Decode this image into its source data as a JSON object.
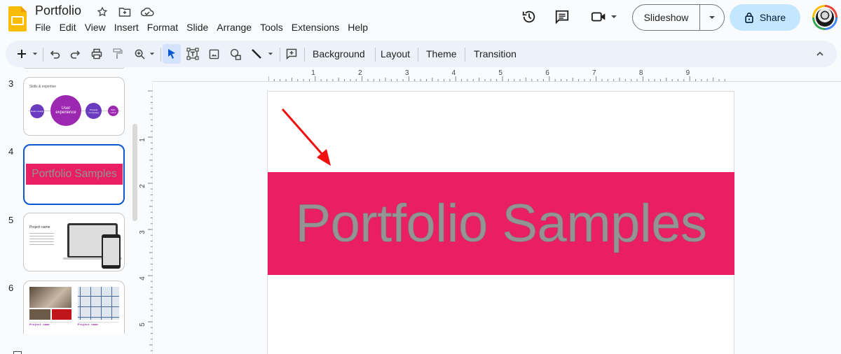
{
  "app": {
    "title": "Portfolio",
    "menu": [
      "File",
      "Edit",
      "View",
      "Insert",
      "Format",
      "Slide",
      "Arrange",
      "Tools",
      "Extensions",
      "Help"
    ],
    "title_icons": [
      "star-icon",
      "move-to-folder-icon",
      "cloud-saved-icon"
    ]
  },
  "header": {
    "slideshow_label": "Slideshow",
    "share_label": "Share",
    "icons": [
      "version-history-icon",
      "comments-icon",
      "meet-icon"
    ]
  },
  "toolbar": {
    "buttons": [
      "new-slide",
      "undo",
      "redo",
      "print",
      "paint-format",
      "zoom",
      "select",
      "text-box",
      "image",
      "shape",
      "line",
      "comment"
    ],
    "background_label": "Background",
    "layout_label": "Layout",
    "theme_label": "Theme",
    "transition_label": "Transition"
  },
  "filmstrip": {
    "slides": [
      {
        "number": "3",
        "title": "Skills & expertise",
        "bubbles": [
          "Motion design",
          "User experience",
          "Physical Computing",
          "Web, UX/UI"
        ]
      },
      {
        "number": "4",
        "title": "Portfolio Samples",
        "selected": true
      },
      {
        "number": "5",
        "title": "Project name"
      },
      {
        "number": "6",
        "captions": [
          "Project name",
          "Project name"
        ]
      }
    ]
  },
  "rulers": {
    "horizontal": [
      "1",
      "2",
      "3",
      "4",
      "5",
      "6",
      "7",
      "8",
      "9"
    ],
    "vertical": [
      "1",
      "2",
      "3",
      "4",
      "5"
    ]
  },
  "slide": {
    "title_text": "Portfolio Samples",
    "band_color": "#e91e63",
    "text_color": "#949494",
    "annotation": "red-arrow"
  },
  "colors": {
    "accent": "#0b57d0",
    "share_bg": "#c2e7ff",
    "toolbar_bg": "#edf2fa",
    "logo": "#fbbc04"
  }
}
